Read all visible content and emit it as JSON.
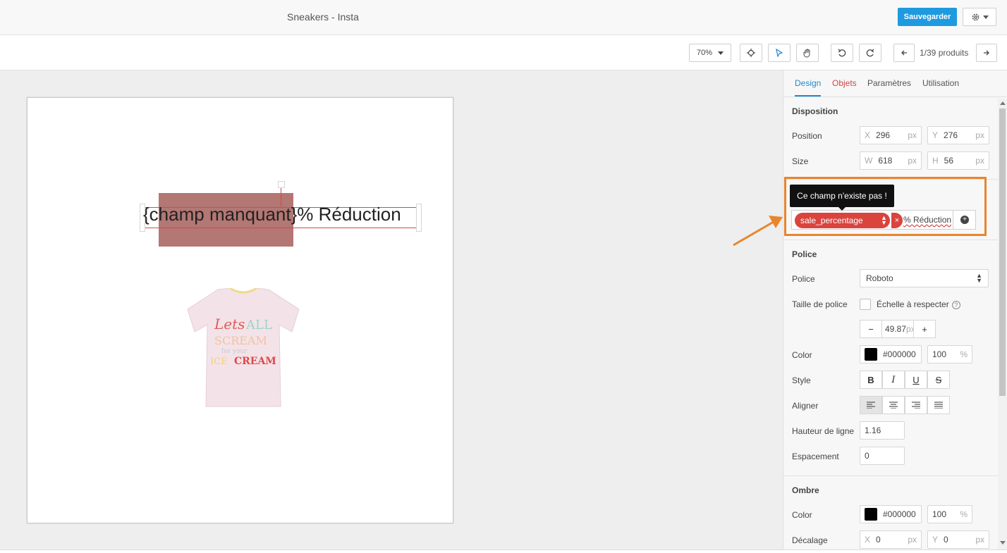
{
  "header": {
    "title": "Sneakers - Insta",
    "save_label": "Sauvegarder"
  },
  "toolbar": {
    "zoom": "70%",
    "pager": "1/39 produits"
  },
  "canvas": {
    "text": "{champ manquant}% Réduction"
  },
  "panel": {
    "tabs": [
      {
        "label": "Design"
      },
      {
        "label": "Objets"
      },
      {
        "label": "Paramètres"
      },
      {
        "label": "Utilisation"
      }
    ],
    "disposition": {
      "title": "Disposition",
      "position_label": "Position",
      "size_label": "Size",
      "x_prefix": "X",
      "x_value": "296",
      "y_prefix": "Y",
      "y_value": "276",
      "w_prefix": "W",
      "w_value": "618",
      "h_prefix": "H",
      "h_value": "56",
      "unit": "px"
    },
    "text_field": {
      "tooltip": "Ce champ n'existe pas !",
      "chip_label": "sale_percentage",
      "chip_remove": "×",
      "suffix": "% Réduction"
    },
    "police": {
      "title": "Police",
      "font_label": "Police",
      "font_value": "Roboto",
      "size_label": "Taille de police",
      "scale_label": "Échelle à respecter",
      "size_value": "49.87",
      "size_unit": "px",
      "minus": "−",
      "plus": "+",
      "color_label": "Color",
      "color_value": "#000000",
      "opacity_value": "100",
      "opacity_unit": "%",
      "style_label": "Style",
      "align_label": "Aligner",
      "line_height_label": "Hauteur de ligne",
      "line_height_value": "1.16",
      "spacing_label": "Espacement",
      "spacing_value": "0",
      "style_buttons": [
        "B",
        "I",
        "U",
        "S"
      ]
    },
    "ombre": {
      "title": "Ombre",
      "color_label": "Color",
      "color_value": "#000000",
      "opacity_value": "100",
      "opacity_unit": "%",
      "offset_label": "Décalage",
      "x_prefix": "X",
      "x_value": "0",
      "y_prefix": "Y",
      "y_value": "0",
      "unit": "px"
    }
  },
  "colors": {
    "accent": "#1e9ae0",
    "error": "#d9443f",
    "highlight": "#e8852d"
  }
}
